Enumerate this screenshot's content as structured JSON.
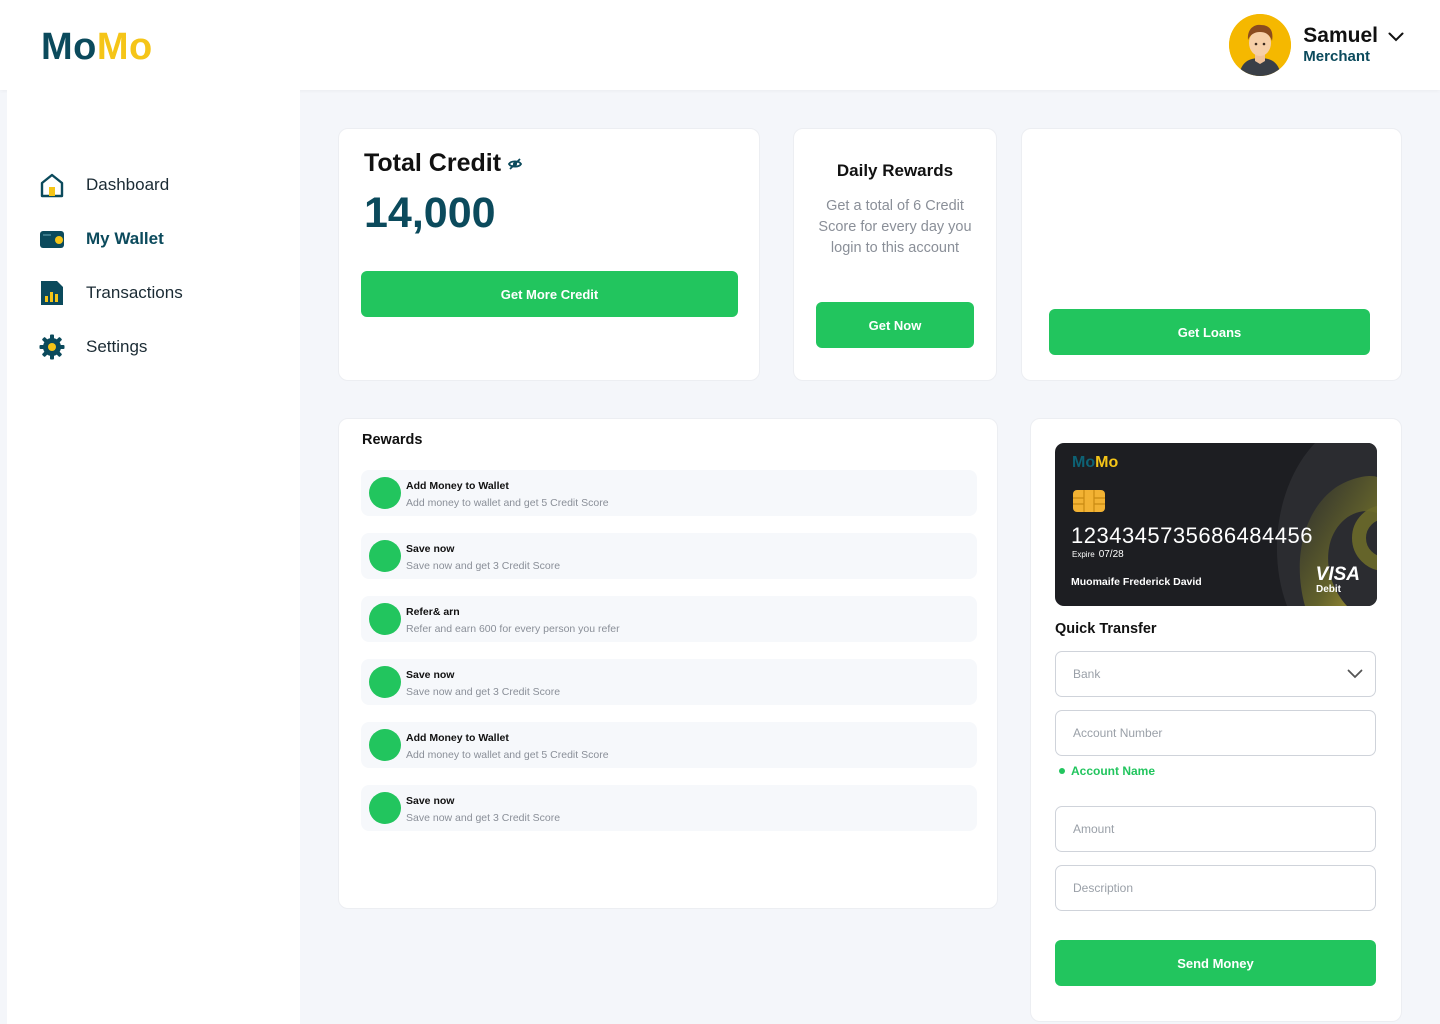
{
  "brand": {
    "part1": "Mo",
    "part2": "Mo"
  },
  "user": {
    "name": "Samuel",
    "role": "Merchant"
  },
  "sidebar": {
    "items": [
      {
        "label": "Dashboard",
        "icon": "home-icon"
      },
      {
        "label": "My Wallet",
        "icon": "wallet-icon",
        "active": true
      },
      {
        "label": "Transactions",
        "icon": "chart-report-icon"
      },
      {
        "label": "Settings",
        "icon": "gear-icon"
      }
    ]
  },
  "credit": {
    "title": "Total Credit",
    "amount": "14,000",
    "button": "Get More Credit"
  },
  "daily": {
    "title": "Daily Rewards",
    "description": "Get a total of 6 Credit Score for every day you login to this account",
    "button": "Get Now"
  },
  "loans": {
    "button": "Get Loans"
  },
  "rewards": {
    "title": "Rewards",
    "items": [
      {
        "name": "Add Money to Wallet",
        "desc": "Add money to wallet and get 5 Credit Score"
      },
      {
        "name": "Save now",
        "desc": "Save now and get 3 Credit Score"
      },
      {
        "name": "Refer& arn",
        "desc": "Refer and earn 600 for every person you refer"
      },
      {
        "name": "Save now",
        "desc": "Save now and get 3 Credit Score"
      },
      {
        "name": "Add Money to Wallet",
        "desc": "Add money to wallet and get 5 Credit Score"
      },
      {
        "name": "Save now",
        "desc": "Save now and get 3 Credit Score"
      }
    ]
  },
  "bank_card": {
    "logo1": "Mo",
    "logo2": "Mo",
    "number": "1234345735686484456",
    "expiry_label": "Expire",
    "expiry": "07/28",
    "holder": "Muomaife Frederick David",
    "network": "VISA",
    "type": "Debit"
  },
  "quick_transfer": {
    "title": "Quick Transfer",
    "bank_placeholder": "Bank",
    "account_number_placeholder": "Account Number",
    "account_name": "Account Name",
    "amount_placeholder": "Amount",
    "description_placeholder": "Description",
    "button": "Send Money"
  },
  "colors": {
    "primary": "#0b4a5c",
    "accent": "#f5c518",
    "green": "#22c55e"
  }
}
